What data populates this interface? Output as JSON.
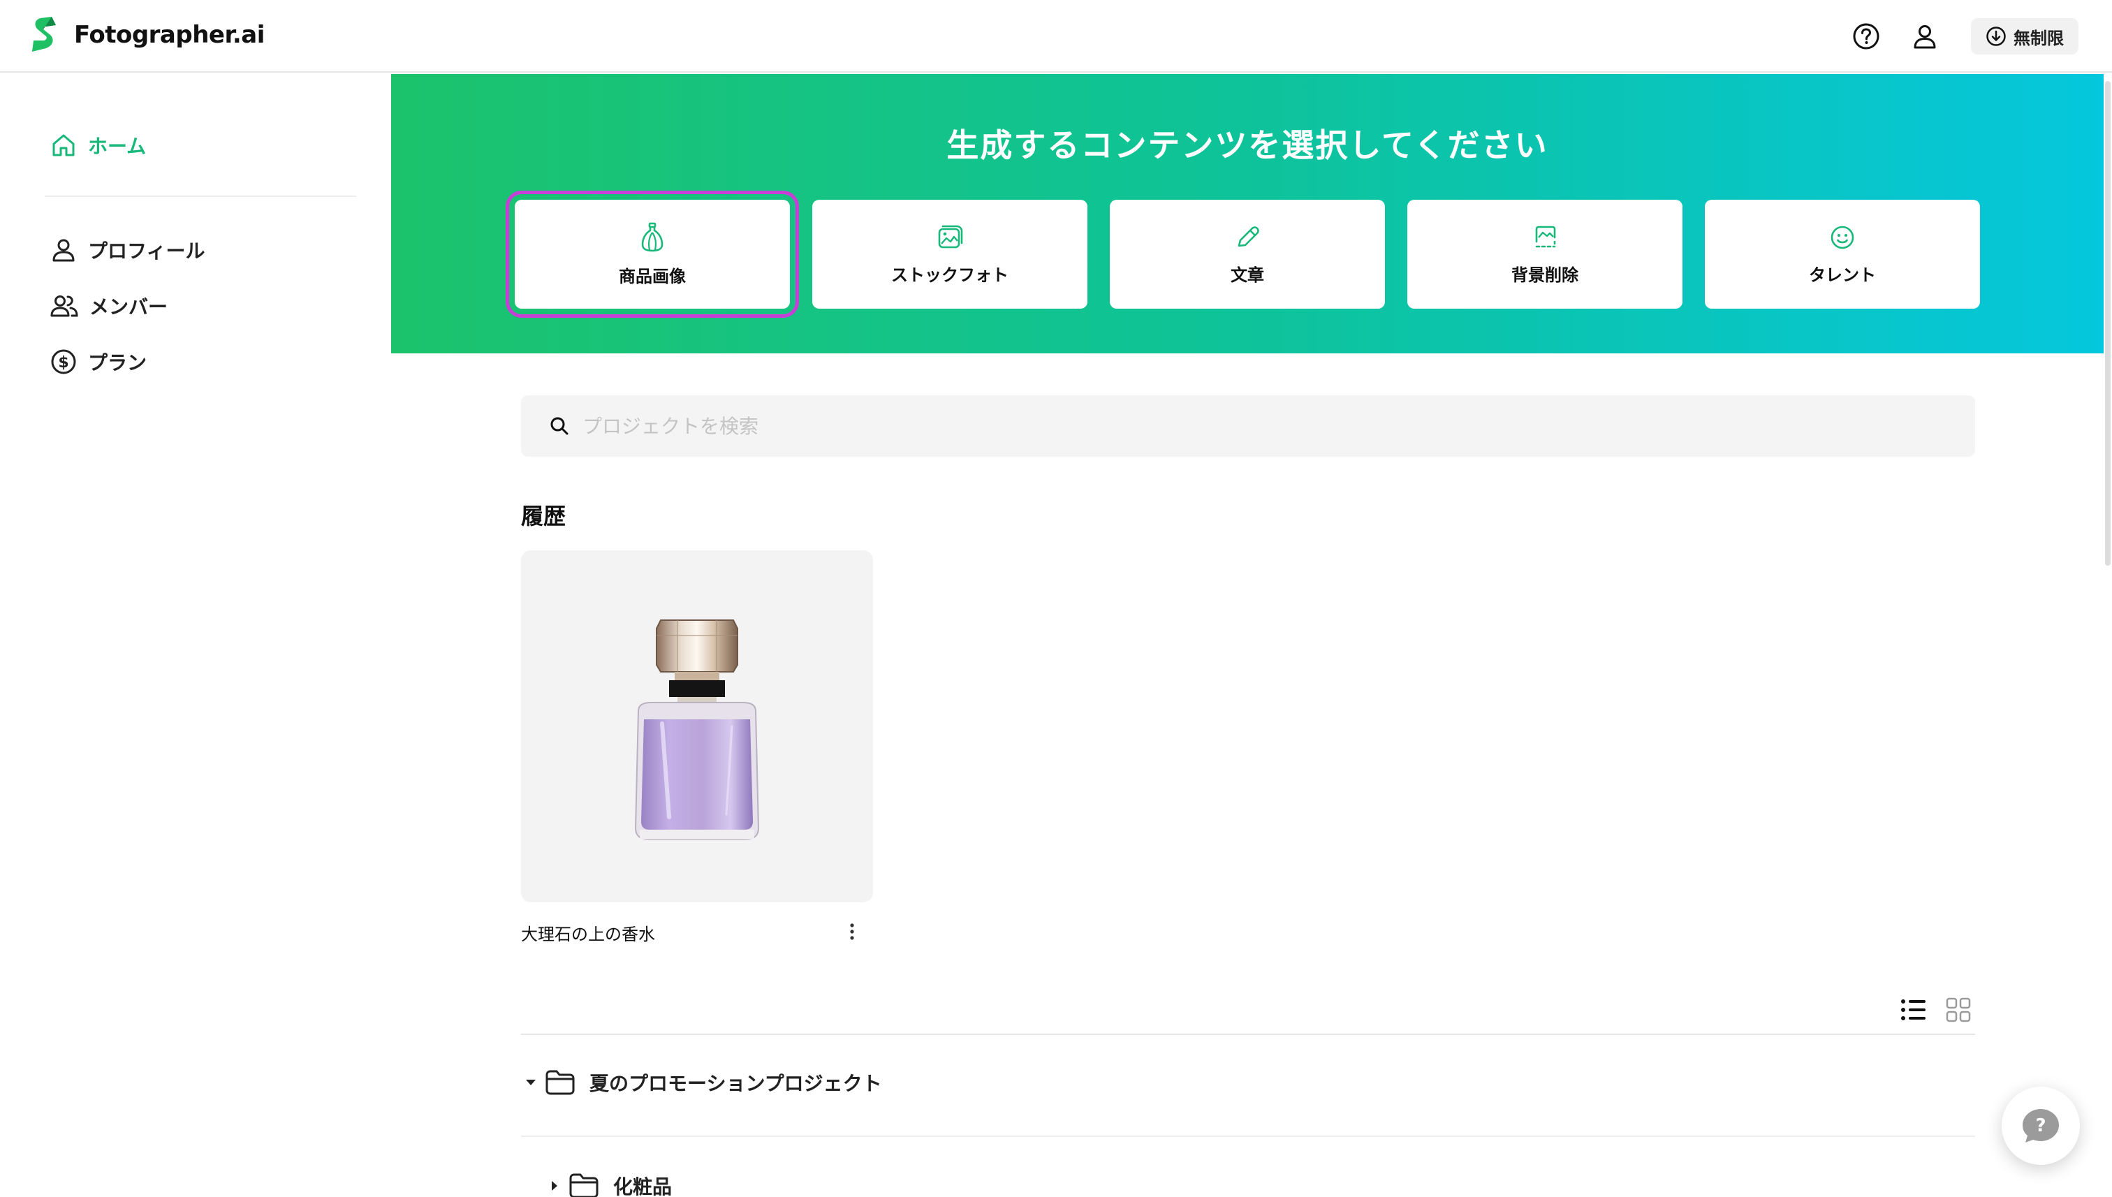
{
  "app": {
    "name": "Fotographer.ai"
  },
  "header": {
    "plan_label": "無制限",
    "icons": [
      "help-circle-icon",
      "user-icon",
      "download-circle-icon"
    ]
  },
  "sidebar": {
    "items": [
      {
        "label": "ホーム",
        "icon": "home-icon",
        "active": true
      },
      {
        "label": "プロフィール",
        "icon": "user-icon"
      },
      {
        "label": "メンバー",
        "icon": "users-icon"
      },
      {
        "label": "プラン",
        "icon": "dollar-circle-icon"
      }
    ]
  },
  "hero": {
    "title": "生成するコンテンツを選択してください",
    "cards": [
      {
        "label": "商品画像",
        "icon": "perfume-bottle-icon",
        "selected": true
      },
      {
        "label": "ストックフォト",
        "icon": "photo-stack-icon"
      },
      {
        "label": "文章",
        "icon": "pencil-icon"
      },
      {
        "label": "背景削除",
        "icon": "image-dashed-icon"
      },
      {
        "label": "タレント",
        "icon": "smiley-icon"
      }
    ]
  },
  "search": {
    "placeholder": "プロジェクトを検索",
    "value": ""
  },
  "history": {
    "title": "履歴",
    "items": [
      {
        "name": "大理石の上の香水",
        "thumbnail": "purple-perfume-bottle"
      }
    ]
  },
  "projects": {
    "view_modes": [
      "list-view-icon",
      "grid-view-icon"
    ],
    "folders": [
      {
        "name": "夏のプロモーションプロジェクト",
        "expanded": true
      },
      {
        "name": "化粧品",
        "expanded": false
      }
    ]
  },
  "colors": {
    "accent_green": "#18b87a",
    "hero_gradient_start": "#1cc36c",
    "hero_gradient_end": "#05c7dd",
    "selection_outline": "#c73fd7",
    "perfume_liquid": "#b9a3d9"
  }
}
